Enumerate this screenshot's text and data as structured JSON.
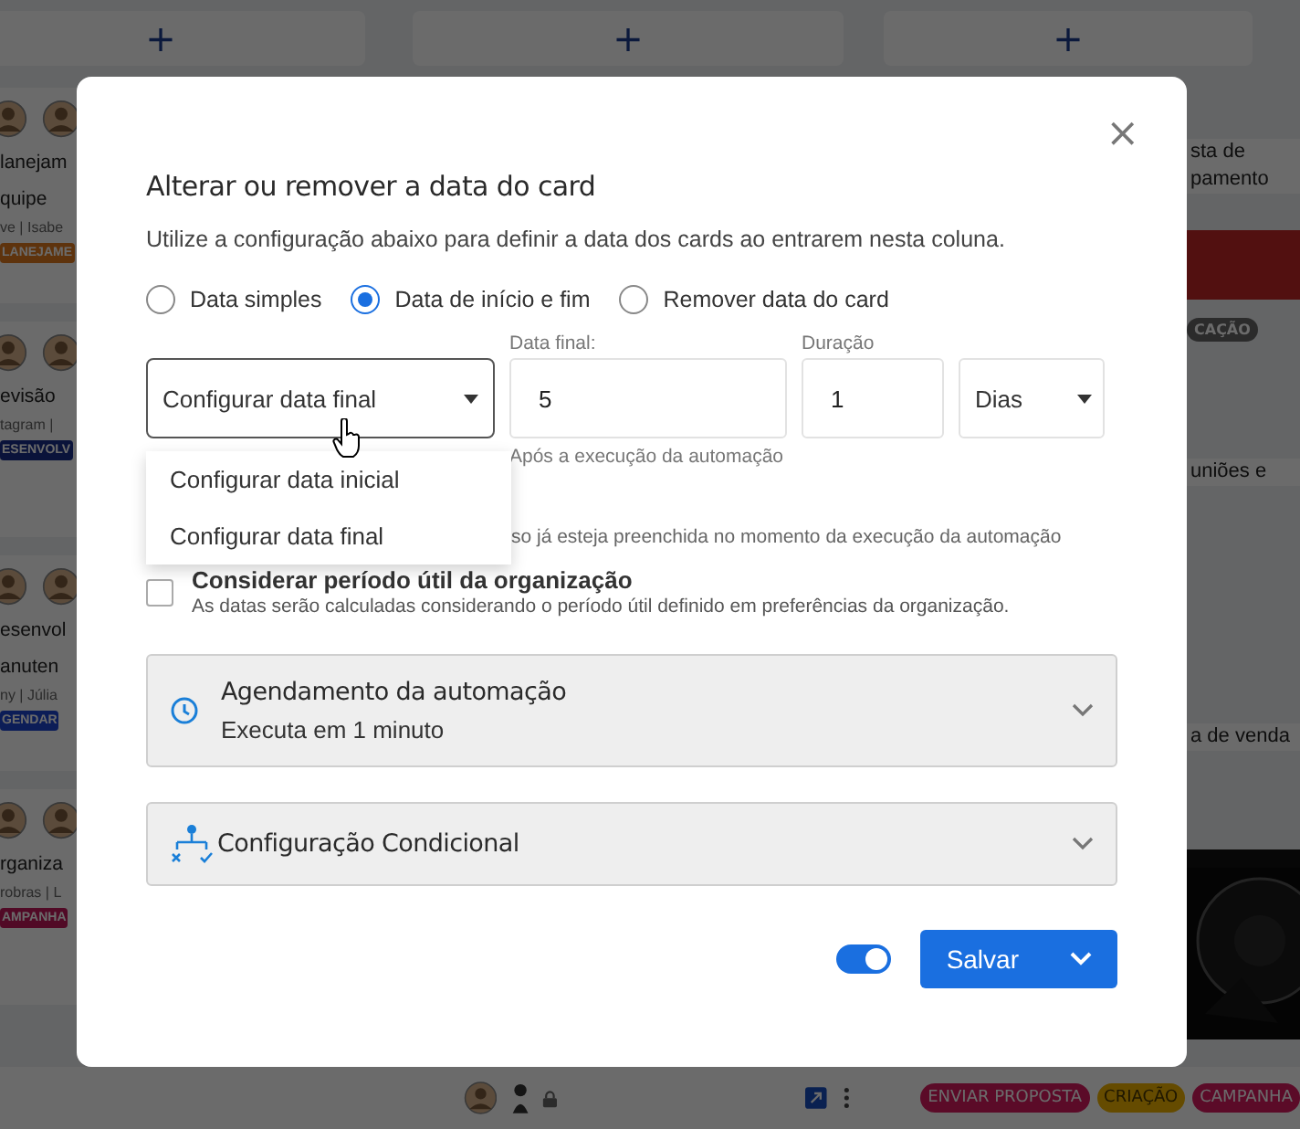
{
  "board": {
    "add_buttons": [
      "+",
      "+",
      "+"
    ],
    "left_cards": [
      {
        "title_lines": [
          "lanejam",
          "quipe"
        ],
        "meta": "ve | Isabe",
        "tag": "LANEJAME"
      },
      {
        "title_lines": [
          "evisão"
        ],
        "meta": "tagram | ",
        "tag": "ESENVOLV"
      },
      {
        "title_lines": [
          "esenvol",
          "anuten"
        ],
        "meta": "ny | Júlia",
        "tag": "GENDAR"
      },
      {
        "title_lines": [
          "rganiza"
        ],
        "meta": "robras | L",
        "tag": "AMPANHA"
      }
    ],
    "right_items": [
      {
        "kind": "title",
        "lines": [
          "sta de",
          "pamento"
        ]
      },
      {
        "kind": "cover"
      },
      {
        "kind": "tag",
        "text": "CAÇÃO"
      },
      {
        "kind": "title",
        "lines": [
          "uniões e"
        ]
      },
      {
        "kind": "title",
        "lines": [
          "a de venda"
        ]
      },
      {
        "kind": "picture"
      }
    ],
    "footer_tags": [
      {
        "text": "ENVIAR PROPOSTA"
      },
      {
        "text": "CRIAÇÃO"
      },
      {
        "text": "CAMPANHA"
      }
    ]
  },
  "dialog": {
    "close": "×",
    "title": "Alterar ou remover a data do card",
    "description": "Utilize a configuração abaixo para definir a data dos cards ao entrarem nesta coluna.",
    "date_modes": [
      {
        "label": "Data simples",
        "selected": false
      },
      {
        "label": "Data de início e fim",
        "selected": true
      },
      {
        "label": "Remover data do card",
        "selected": false
      }
    ],
    "target_select": {
      "value": "Configurar data final",
      "expanded": true,
      "options": [
        "Configurar data inicial",
        "Configurar data final"
      ]
    },
    "date_field": {
      "label": "Data final:",
      "value": "5",
      "helper": "Após a execução da automação"
    },
    "duration_field": {
      "label": "Duração",
      "value": "1"
    },
    "unit_select": {
      "value": "Dias"
    },
    "partial_note": "so já esteja preenchida no momento da execução da automação",
    "business_period": {
      "label": "Considerar período útil da organização",
      "hint": "As datas serão calculadas considerando o período útil definido em preferências da organização.",
      "checked": false
    },
    "sections": [
      {
        "kind": "schedule",
        "title": "Agendamento da automação",
        "subtitle": "Executa em 1 minuto",
        "expanded": false
      },
      {
        "kind": "conditional",
        "title": "Configuração Condicional",
        "expanded": false
      }
    ],
    "active_toggle": {
      "on": true
    },
    "save_button": "Salvar"
  }
}
